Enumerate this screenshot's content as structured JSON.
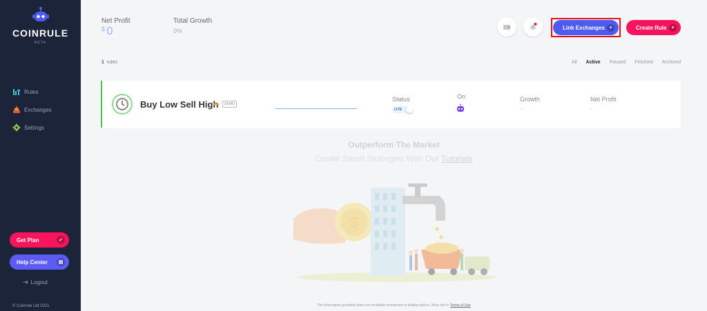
{
  "sidebar": {
    "brand": "COINRULE",
    "badge": "BETA",
    "nav": [
      {
        "label": "Rules",
        "icon": "rules-icon"
      },
      {
        "label": "Exchanges",
        "icon": "exchanges-icon"
      },
      {
        "label": "Settings",
        "icon": "gear-icon"
      }
    ],
    "get_plan_label": "Get Plan",
    "help_center_label": "Help Center",
    "logout_label": "Logout",
    "copyright": "© Coinrule Ltd 2021"
  },
  "header": {
    "net_profit_label": "Net Profit",
    "net_profit_currency": "$",
    "net_profit_value": "0",
    "total_growth_label": "Total Growth",
    "total_growth_value": "0%",
    "link_exchanges_label": "Link Exchanges",
    "create_rule_label": "Create Rule"
  },
  "rules": {
    "count": "1",
    "count_label": "rules",
    "filters": [
      "All",
      "Active",
      "Paused",
      "Finished",
      "Archived"
    ],
    "active_filter": "Active"
  },
  "rule_card": {
    "name": "Buy Low Sell High",
    "badge": "DEMO",
    "status_label": "Status",
    "status_value": "LIVE",
    "on_label": "On",
    "growth_label": "Growth",
    "growth_value": "--",
    "net_profit_label": "Net Profit",
    "net_profit_value": "-"
  },
  "promo": {
    "title": "Outperform The Market",
    "subtitle": "Create Smart Strategies With Our",
    "link": "Tutorials"
  },
  "footer": {
    "disclaimer": "The information provided does not constitute investment or trading advice. More info in",
    "terms_link": "Terms of Use"
  },
  "colors": {
    "sidebar_bg": "#1b2438",
    "primary_pink": "#f8145d",
    "primary_blue": "#4e5bf0",
    "live_green": "#3fc64a"
  }
}
